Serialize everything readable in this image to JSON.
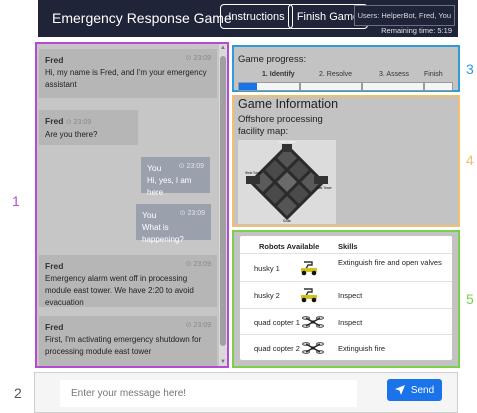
{
  "header": {
    "title": "Emergency Response Game",
    "instructions_label": "Instructions",
    "finish_label": "Finish Game",
    "users": "Users: HelperBot, Fred, You",
    "remaining_time": "Remaining time: 5:19"
  },
  "annotations": [
    "1",
    "2",
    "3",
    "4",
    "5"
  ],
  "colors": {
    "header_bg": "#1f2438",
    "chat_border": "#b44bd1",
    "progress_border": "#2e9bd6",
    "info_border": "#f0c070",
    "robots_border": "#7ccf4c",
    "send_button": "#1a73e8"
  },
  "chat": {
    "messages": [
      {
        "sender": "Fred",
        "time": "23:09",
        "text": "Hi, my name is Fred, and I'm your emergency assistant",
        "mine": false
      },
      {
        "sender": "Fred",
        "time": "23:09",
        "text": "Are you there?",
        "mine": false
      },
      {
        "sender": "You",
        "time": "23:09",
        "text": "Hi, yes, I am here",
        "mine": true
      },
      {
        "sender": "You",
        "time": "23:09",
        "text": "What is happening?",
        "mine": true
      },
      {
        "sender": "Fred",
        "time": "23:09",
        "text": "Emergency alarm went off in processing module east tower. We have 2:20 to avoid evacuation",
        "mine": false
      },
      {
        "sender": "Fred",
        "time": "23:09",
        "text": "First, I'm activating emergency shutdown for processing module east tower",
        "mine": false
      }
    ]
  },
  "message_bar": {
    "placeholder": "Enter your message here!",
    "send_label": "Send",
    "send_icon": "paper-plane-icon"
  },
  "progress": {
    "title": "Game progress:",
    "stages": [
      "1. Identify",
      "2. Resolve",
      "3. Assess",
      "Finish"
    ],
    "current_stage": "1. Identify",
    "fill_fraction": 0.25
  },
  "info": {
    "title": "Game Information",
    "map_caption": "Offshore processing facility map:",
    "map_labels": [
      "North Tower",
      "West Tower",
      "East Tower",
      "South"
    ]
  },
  "robots": {
    "headers": {
      "robot": "Robots Available",
      "skills": "Skills"
    },
    "rows": [
      {
        "name": "husky 1",
        "icon": "husky-robot-icon",
        "skills": "Extinguish fire and open valves"
      },
      {
        "name": "husky 2",
        "icon": "husky-robot-icon",
        "skills": "Inspect"
      },
      {
        "name": "quad copter 1",
        "icon": "quadcopter-icon",
        "skills": "Inspect"
      },
      {
        "name": "quad copter 2",
        "icon": "quadcopter-icon",
        "skills": "Extinguish fire"
      }
    ]
  }
}
